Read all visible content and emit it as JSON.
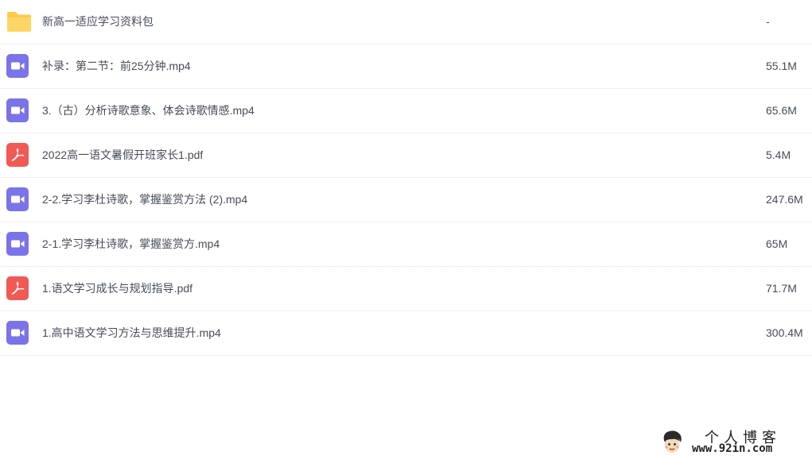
{
  "files": [
    {
      "type": "folder",
      "icon": "folder-icon",
      "name": "新高一适应学习资料包",
      "size": "-"
    },
    {
      "type": "video",
      "icon": "video-file-icon",
      "name": "补录：第二节：前25分钟.mp4",
      "size": "55.1M"
    },
    {
      "type": "video",
      "icon": "video-file-icon",
      "name": "3.（古）分析诗歌意象、体会诗歌情感.mp4",
      "size": "65.6M"
    },
    {
      "type": "pdf",
      "icon": "pdf-file-icon",
      "name": "2022高一语文暑假开班家长1.pdf",
      "size": "5.4M"
    },
    {
      "type": "video",
      "icon": "video-file-icon",
      "name": "2-2.学习李杜诗歌，掌握鉴赏方法 (2).mp4",
      "size": "247.6M"
    },
    {
      "type": "video",
      "icon": "video-file-icon",
      "name": "2-1.学习李杜诗歌，掌握鉴赏方.mp4",
      "size": "65M"
    },
    {
      "type": "pdf",
      "icon": "pdf-file-icon",
      "name": "1.语文学习成长与规划指导.pdf",
      "size": "71.7M"
    },
    {
      "type": "video",
      "icon": "video-file-icon",
      "name": "1.高中语文学习方法与思维提升.mp4",
      "size": "300.4M"
    }
  ],
  "watermark": {
    "title": "个人博客",
    "url": "www.92in.com"
  },
  "colors": {
    "folder": "#ffc94d",
    "video": "#7b73e8",
    "pdf": "#f05a55",
    "text": "#454d5a",
    "divider": "#eef0f4"
  }
}
